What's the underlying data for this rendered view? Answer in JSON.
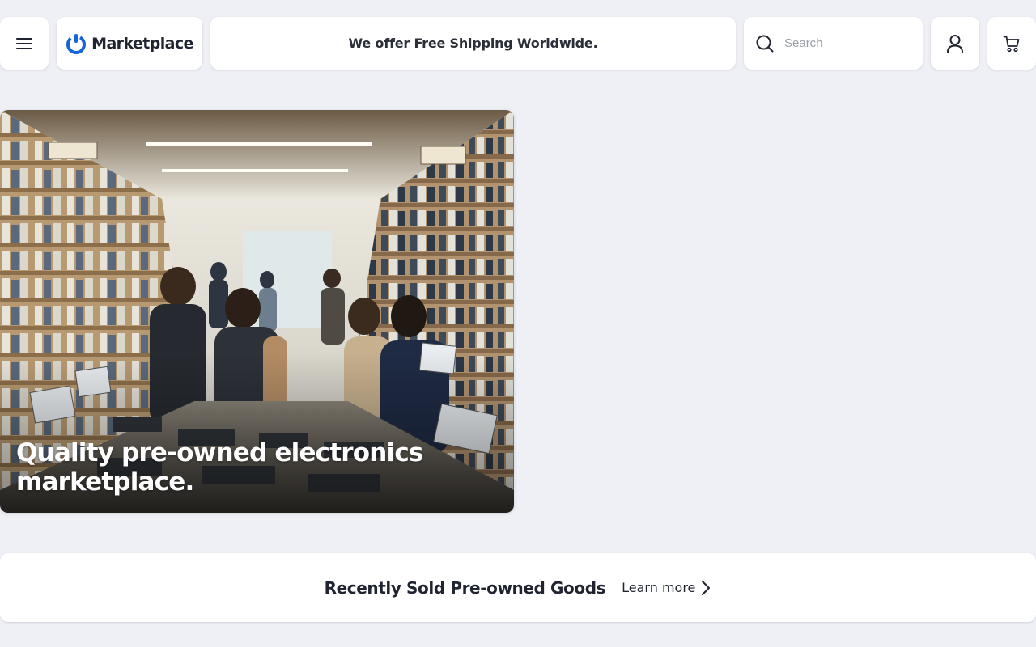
{
  "header": {
    "menu_icon": "hamburger-menu-icon",
    "logo": {
      "text": "Marketplace",
      "icon": "marketplace-logo-icon",
      "brand_color": "#1565d8"
    },
    "promo": "We offer Free Shipping Worldwide.",
    "search": {
      "placeholder": "Search",
      "value": "",
      "icon": "search-icon"
    },
    "account_icon": "user-icon",
    "cart_icon": "cart-icon"
  },
  "hero": {
    "title": "Quality pre-owned electronics marketplace.",
    "image": "electronics-store-photo"
  },
  "recent": {
    "title": "Recently Sold Pre-owned Goods",
    "link_label": "Learn more",
    "link_icon": "chevron-right-icon"
  },
  "colors": {
    "background": "#eef0f5",
    "card": "#ffffff",
    "text": "#1f2430",
    "brand": "#1565d8"
  }
}
